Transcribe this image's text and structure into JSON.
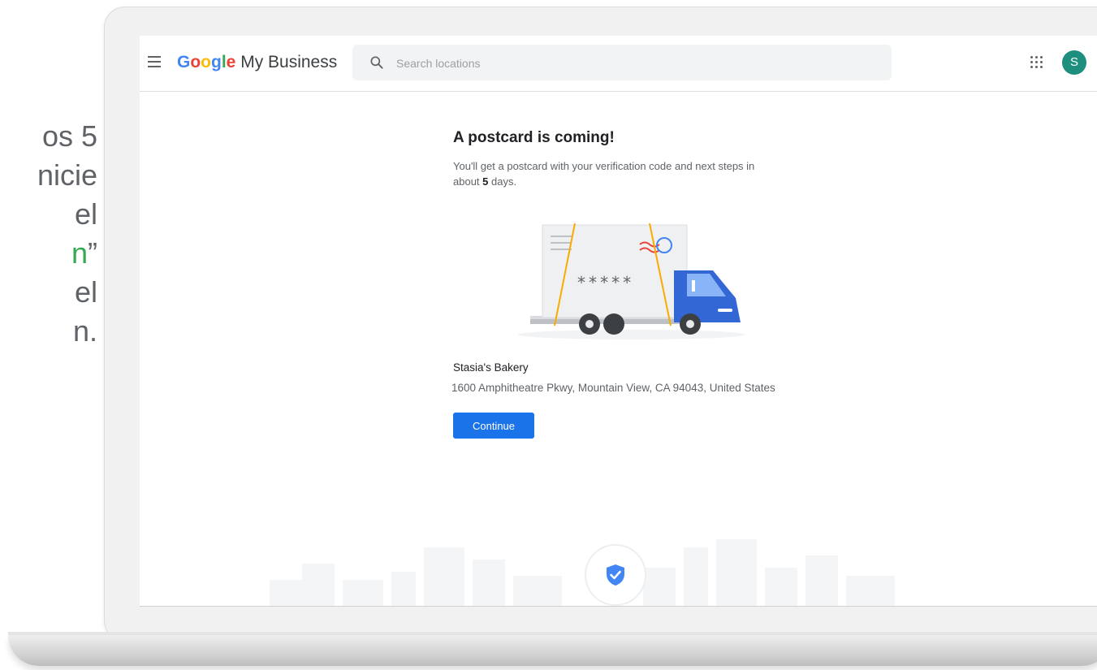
{
  "slide": {
    "lines": [
      "os 5",
      "nicie",
      "el",
      "n",
      "”",
      "el",
      "n."
    ]
  },
  "header": {
    "brand_google": "Google",
    "brand_product": "My Business",
    "search_placeholder": "Search locations",
    "avatar_initial": "S"
  },
  "main": {
    "title": "A postcard is coming!",
    "description_pre": "You'll get a postcard with your verification code and next steps in about ",
    "description_days": "5",
    "description_post": " days.",
    "postcard_code": "*****",
    "business_name": "Stasia's Bakery",
    "business_address": "1600 Amphitheatre Pkwy, Mountain View, CA 94043, United States",
    "continue_label": "Continue"
  },
  "colors": {
    "primary_button": "#1a73e8",
    "avatar": "#1e8e7e",
    "truck": "#3367d6",
    "highlight_green": "#34a853"
  },
  "icons": [
    "menu-icon",
    "search-icon",
    "apps-icon",
    "shield-check-icon"
  ]
}
